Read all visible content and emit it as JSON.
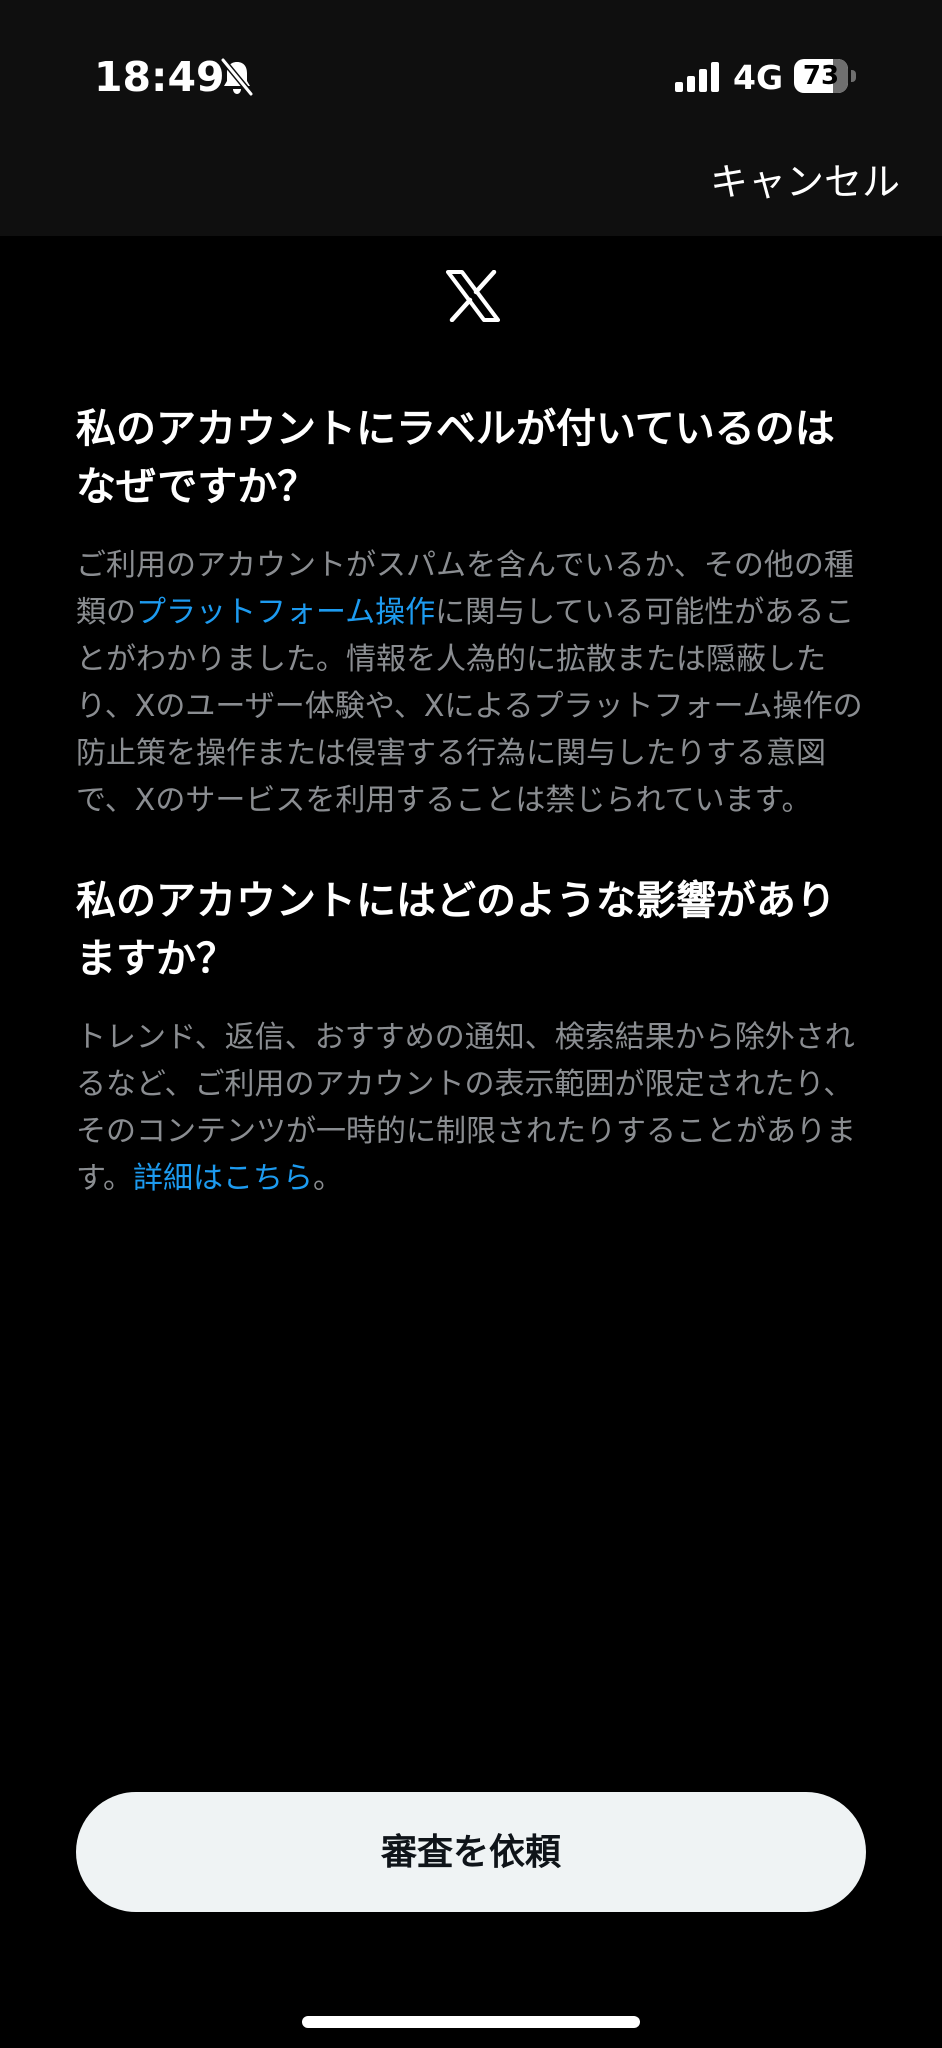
{
  "status_bar": {
    "time": "18:49",
    "network": "4G",
    "battery_percent": "73",
    "battery_level": 0.73,
    "silent_mode_icon": "bell-slash-icon",
    "signal_icon": "cellular-signal-icon"
  },
  "header": {
    "cancel_label": "キャンセル",
    "logo_icon": "x-logo-icon"
  },
  "section_1": {
    "title": "私のアカウントにラベルが付いているのはなぜですか？",
    "body_before_link": "ご利用のアカウントがスパムを含んでいるか、その他の種類の",
    "link_text": "プラットフォーム操作",
    "body_after_link": "に関与している可能性があることがわかりました。情報を人為的に拡散または隠蔽したり、Xのユーザー体験や、Xによるプラットフォーム操作の防止策を操作または侵害する行為に関与したりする意図で、Xのサービスを利用することは禁じられています。"
  },
  "section_2": {
    "title": "私のアカウントにはどのような影響がありますか？",
    "body_before_link": "トレンド、返信、おすすめの通知、検索結果から除外されるなど、ご利用のアカウントの表示範囲が限定されたり、そのコンテンツが一時的に制限されたりすることがあります。",
    "link_text": "詳細はこちら",
    "body_after_link": "。"
  },
  "footer": {
    "request_button_label": "審査を依頼"
  },
  "colors": {
    "background": "#000000",
    "top_bar": "#0f0f0f",
    "link": "#1d9bf0",
    "body_text": "#8a8d91",
    "button_bg": "#eff3f4",
    "button_text": "#0f1419"
  }
}
